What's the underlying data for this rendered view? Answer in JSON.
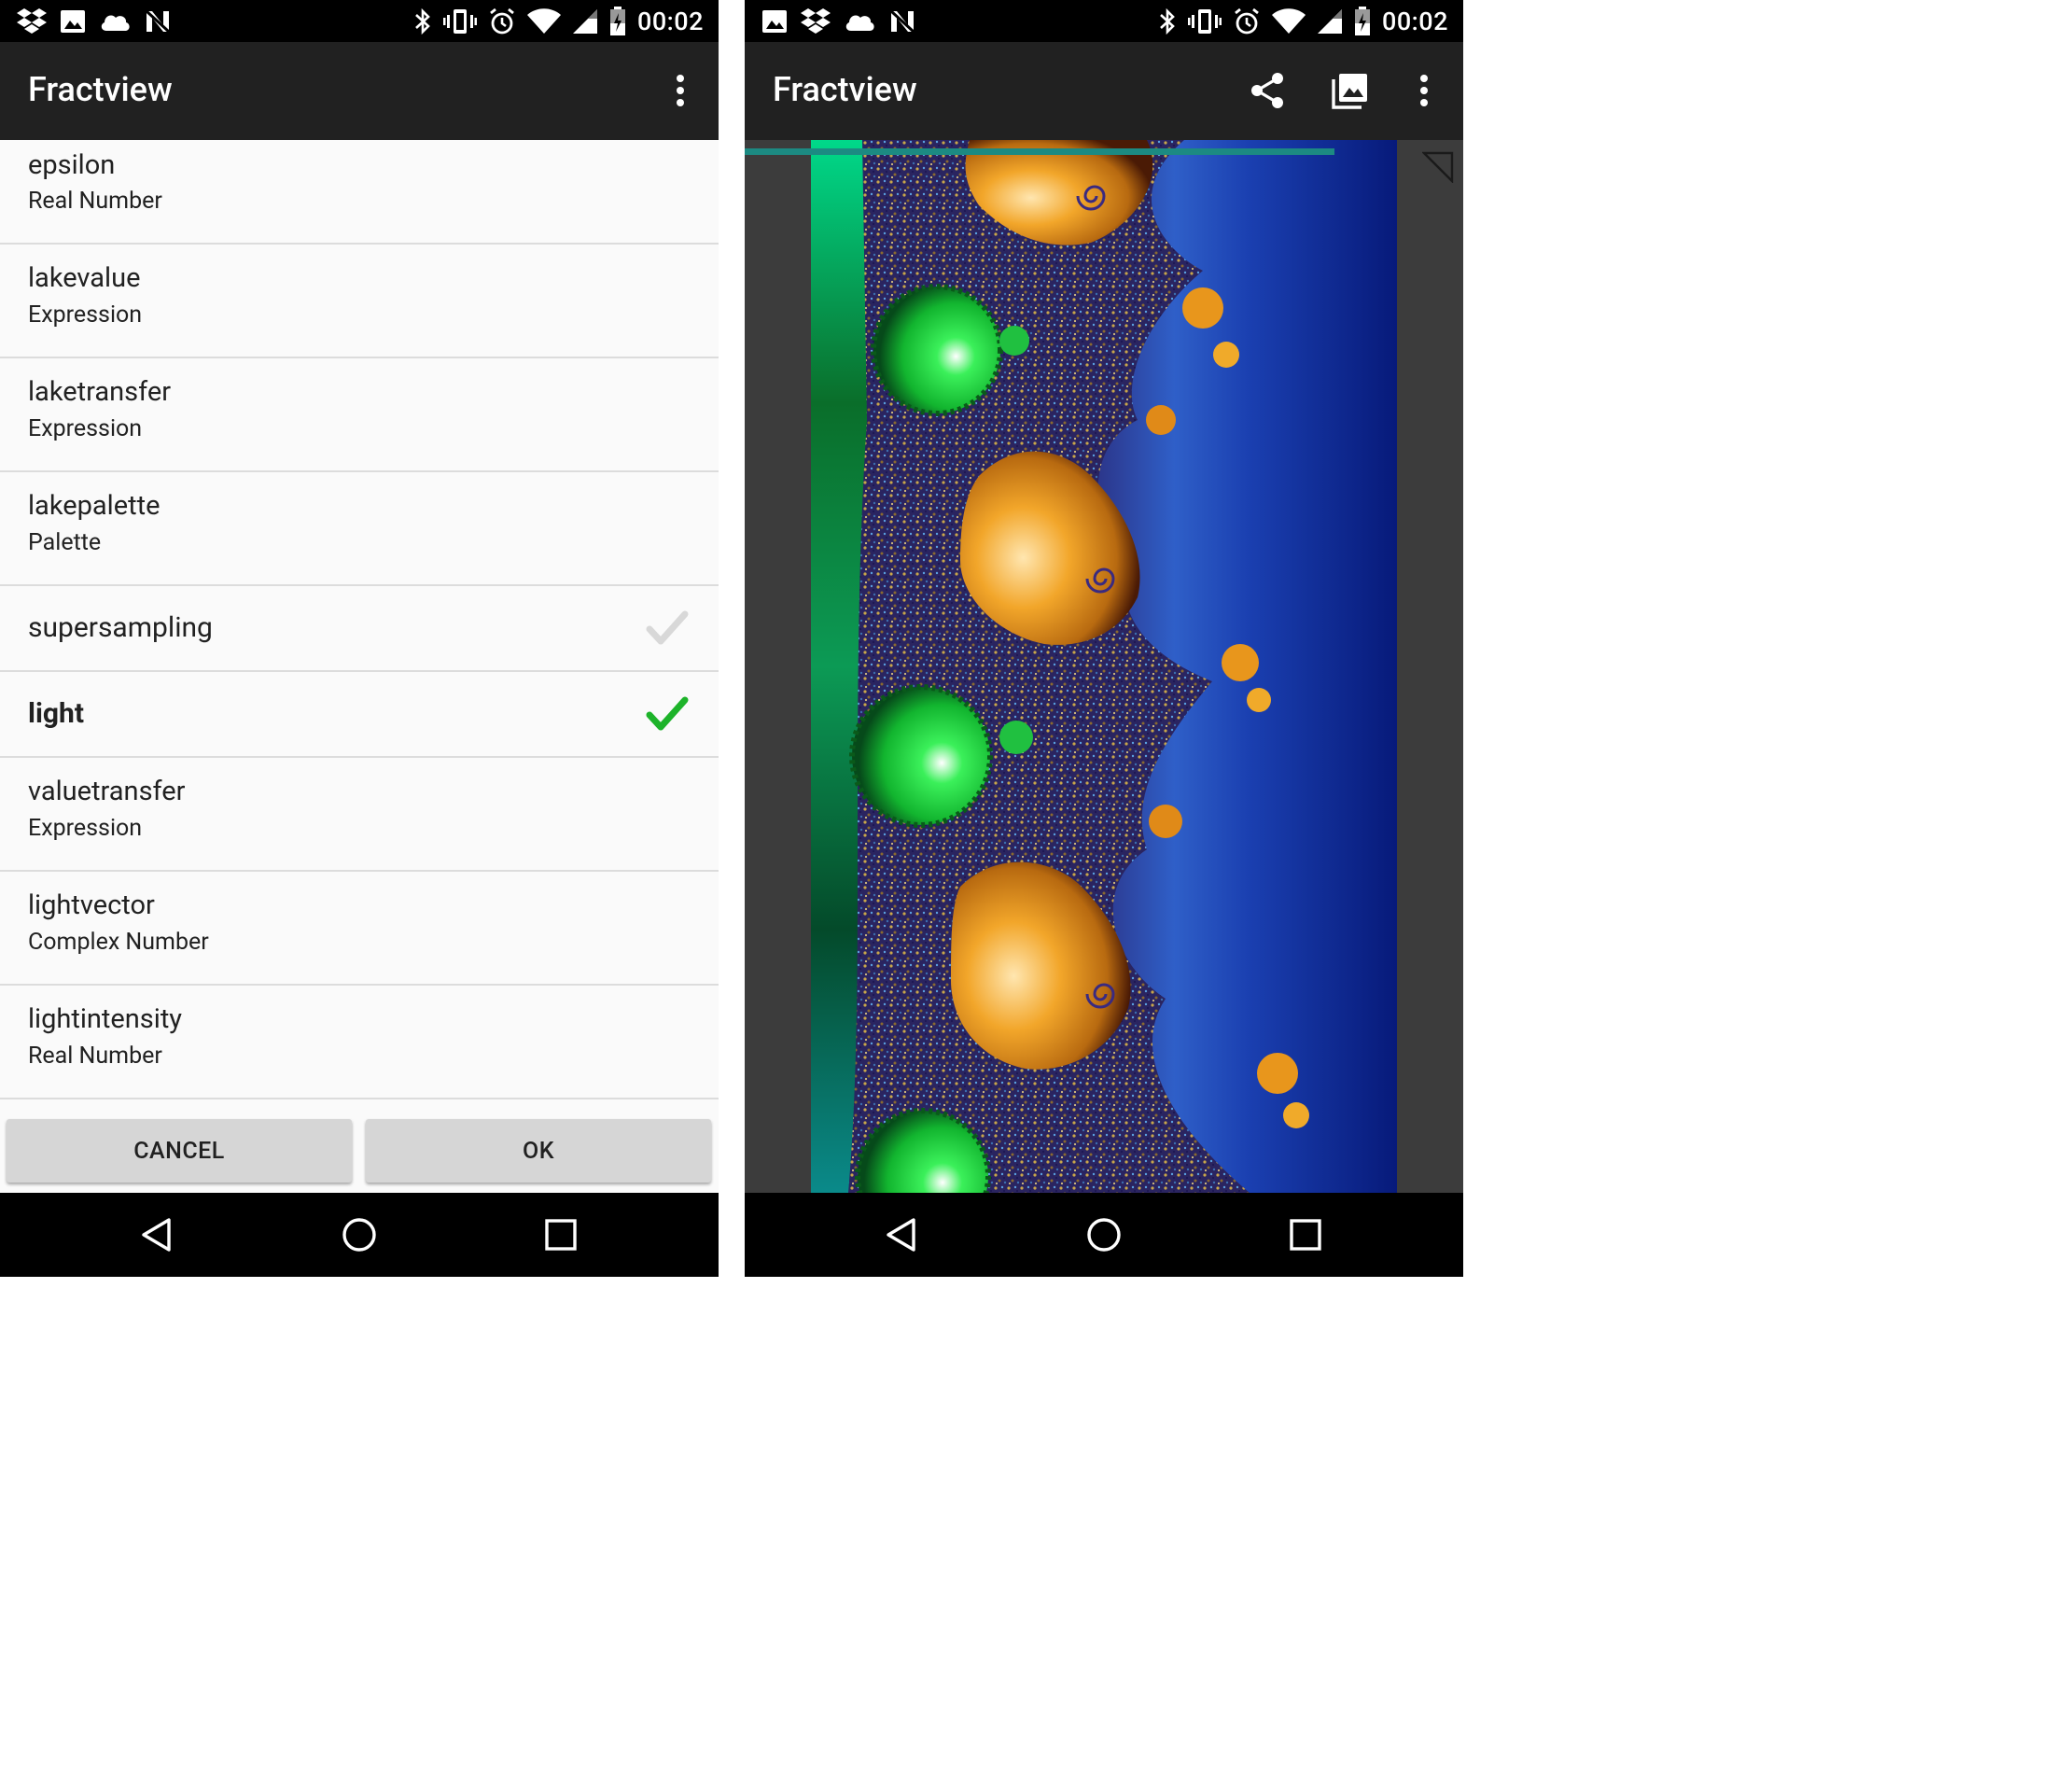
{
  "status_bar": {
    "time": "00:02"
  },
  "left_screen": {
    "toolbar": {
      "title": "Fractview",
      "overflow_menu_icon": "more-vert-icon"
    },
    "parameters": [
      {
        "title": "epsilon",
        "subtitle": "Real Number"
      },
      {
        "title": "lakevalue",
        "subtitle": "Expression"
      },
      {
        "title": "laketransfer",
        "subtitle": "Expression"
      },
      {
        "title": "lakepalette",
        "subtitle": "Palette"
      },
      {
        "title": "supersampling",
        "checked": false
      },
      {
        "title": "light",
        "checked": true
      },
      {
        "title": "valuetransfer",
        "subtitle": "Expression"
      },
      {
        "title": "lightvector",
        "subtitle": "Complex Number"
      },
      {
        "title": "lightintensity",
        "subtitle": "Real Number"
      }
    ],
    "buttons": {
      "cancel": "CANCEL",
      "ok": "OK"
    }
  },
  "right_screen": {
    "toolbar": {
      "title": "Fractview",
      "share_icon": "share-icon",
      "gallery_icon": "gallery-icon",
      "overflow_menu_icon": "more-vert-icon"
    }
  },
  "colors": {
    "toolbar": "#212121",
    "status_bar": "#000000",
    "list_background": "#fafafa",
    "check_active": "#1db32a",
    "check_inactive": "#d8d8d8",
    "progress": "#1c8a82",
    "button": "#d6d6d6"
  }
}
